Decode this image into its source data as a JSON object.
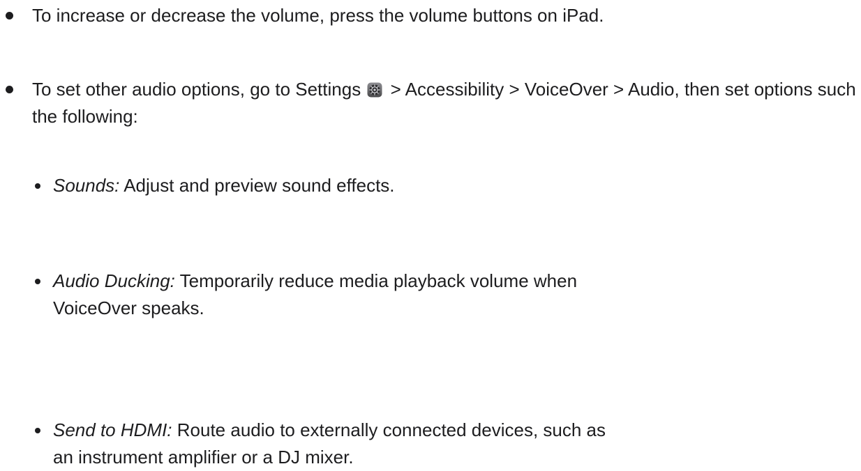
{
  "items": [
    {
      "text": "To increase or decrease the volume, press the volume buttons on iPad."
    },
    {
      "text_before_icon": "To set other audio options, go to Settings",
      "icon": "settings-gear-icon",
      "text_after_icon": "> Accessibility > VoiceOver > Audio, then set options such as the following:",
      "subitems": [
        {
          "term": "Sounds:",
          "text": "Adjust and preview sound effects."
        },
        {
          "term": "Audio Ducking:",
          "text": "Temporarily reduce media playback volume when VoiceOver speaks."
        },
        {
          "term": "Send to HDMI:",
          "text": "Route audio to externally connected devices, such as an instrument amplifier or a DJ mixer."
        }
      ]
    }
  ],
  "colors": {
    "text": "#1d1d1f",
    "background": "#ffffff",
    "icon_outer": "#5f6368",
    "icon_inner": "#c7c7cc"
  }
}
